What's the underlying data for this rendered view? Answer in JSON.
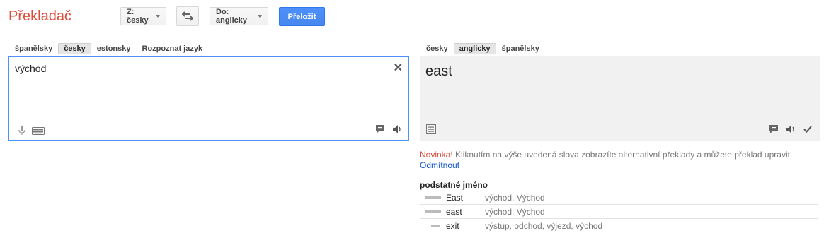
{
  "header": {
    "title": "Překladač",
    "from_label": "Z: česky",
    "to_label": "Do: anglicky",
    "translate_label": "Přeložit"
  },
  "source": {
    "tabs": [
      "španělsky",
      "česky",
      "estonsky",
      "Rozpoznat jazyk"
    ],
    "active_tab": "česky",
    "text": "východ"
  },
  "target": {
    "tabs": [
      "česky",
      "anglicky",
      "španělsky"
    ],
    "active_tab": "anglicky",
    "text": "east"
  },
  "notice": {
    "prefix": "Novinka!",
    "text": " Kliknutím na výše uvedená slova zobrazíte alternativní překlady a můžete překlad upravit.",
    "dismiss": "Odmítnout"
  },
  "dictionary": {
    "part_of_speech": "podstatné jméno",
    "entries": [
      {
        "word": "East",
        "alternatives": "východ, Východ",
        "frequency": 1.0
      },
      {
        "word": "east",
        "alternatives": "východ, Východ",
        "frequency": 1.0
      },
      {
        "word": "exit",
        "alternatives": "výstup, odchod, výjezd, východ",
        "frequency": 0.6
      }
    ]
  },
  "colors": {
    "brand_red": "#dd4b39",
    "accent_blue": "#4d90fe",
    "link_blue": "#1155cc"
  }
}
